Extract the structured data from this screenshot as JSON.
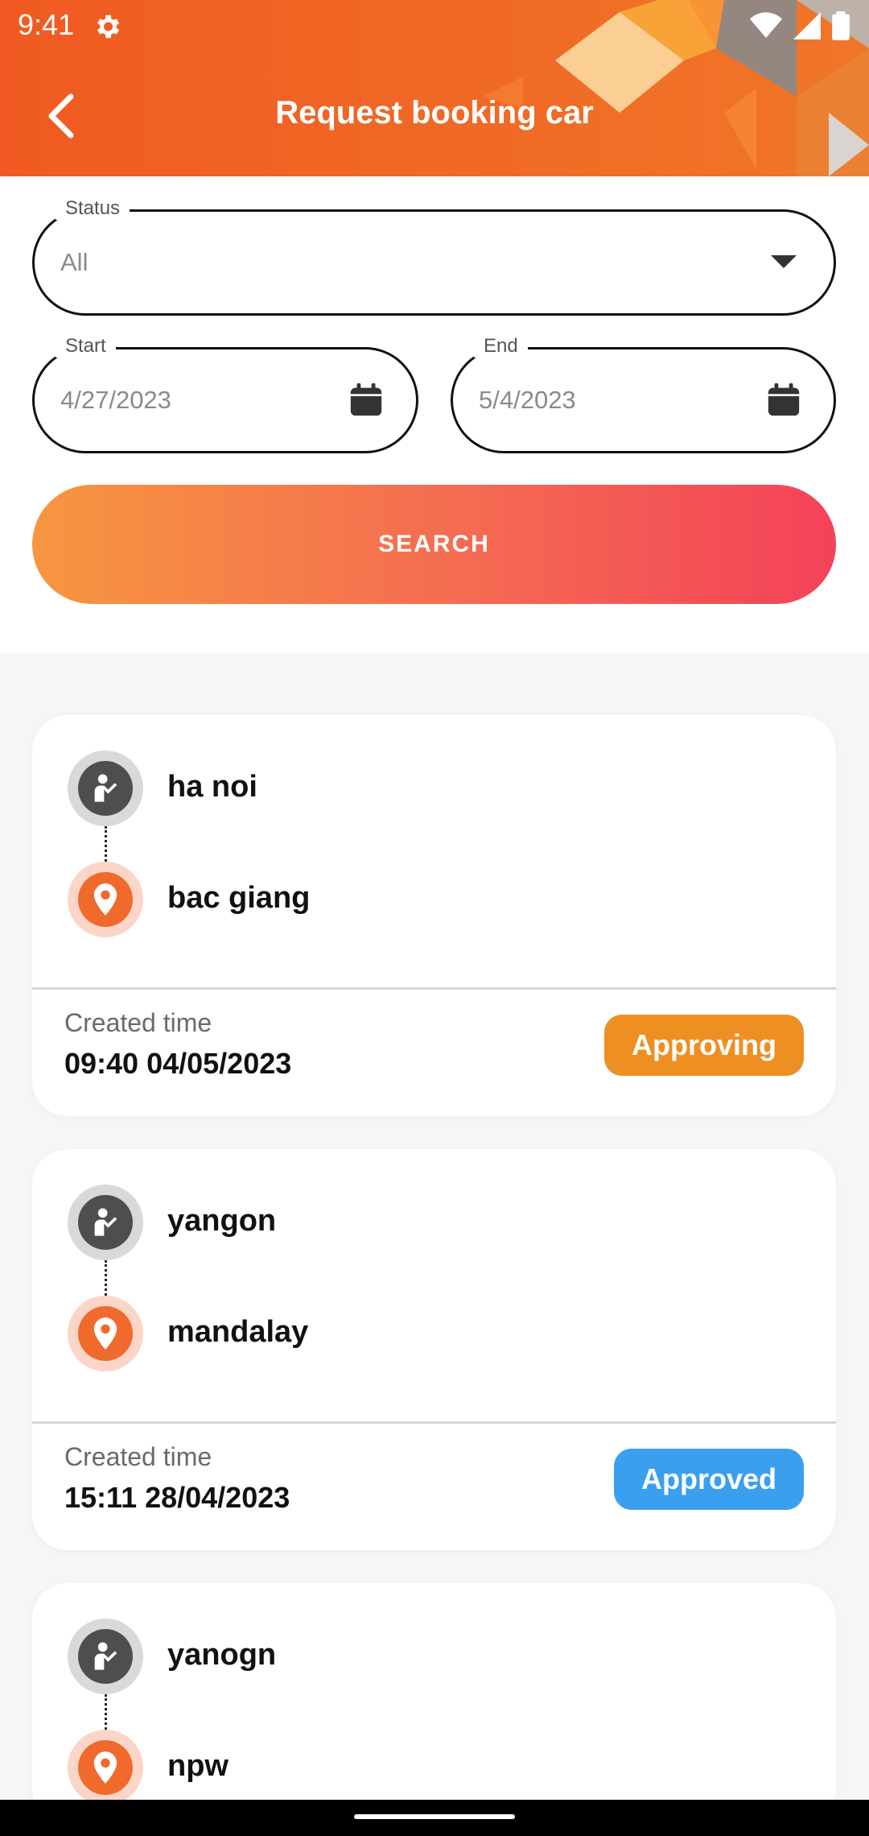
{
  "status_bar": {
    "time": "9:41",
    "icons": [
      "gear-icon",
      "wifi-icon",
      "signal-icon",
      "battery-icon"
    ]
  },
  "header": {
    "title": "Request booking car",
    "back_icon": "chevron-left-icon"
  },
  "filters": {
    "status": {
      "label": "Status",
      "value": "All",
      "icon": "caret-down-icon"
    },
    "start": {
      "label": "Start",
      "value": "4/27/2023",
      "icon": "calendar-icon"
    },
    "end": {
      "label": "End",
      "value": "5/4/2023",
      "icon": "calendar-icon"
    },
    "search_label": "SEARCH"
  },
  "bookings": [
    {
      "origin": "ha noi",
      "destination": "bac giang",
      "created_label": "Created time",
      "created_time": "09:40 04/05/2023",
      "status": "Approving",
      "status_color": "#ee8f22"
    },
    {
      "origin": "yangon",
      "destination": "mandalay",
      "created_label": "Created time",
      "created_time": "15:11 28/04/2023",
      "status": "Approved",
      "status_color": "#3b9ff0"
    },
    {
      "origin": "yanogn",
      "destination": "npw"
    }
  ],
  "colors": {
    "header_start": "#f05a22",
    "header_end": "#f07628",
    "search_start": "#f69640",
    "search_end": "#f44258"
  }
}
